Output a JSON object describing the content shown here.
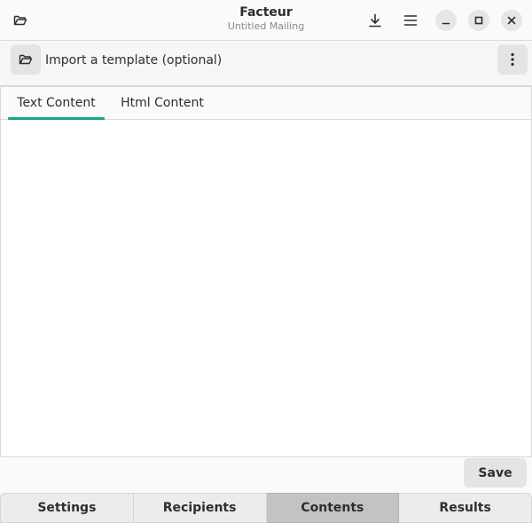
{
  "header": {
    "title": "Facteur",
    "subtitle": "Untitled Mailing",
    "icons": {
      "open": "folder-open-icon",
      "download": "download-icon",
      "menu": "hamburger-menu-icon",
      "minimize": "minimize-icon",
      "maximize": "maximize-icon",
      "close": "close-icon"
    }
  },
  "toolbar": {
    "import_label": "Import a template (optional)",
    "icons": {
      "import": "folder-open-icon",
      "more": "kebab-menu-icon"
    }
  },
  "editor_tabs": [
    {
      "label": "Text Content",
      "active": true
    },
    {
      "label": "Html Content",
      "active": false
    }
  ],
  "editor": {
    "text": ""
  },
  "actions": {
    "save_label": "Save"
  },
  "bottom_nav": [
    {
      "label": "Settings",
      "selected": false
    },
    {
      "label": "Recipients",
      "selected": false
    },
    {
      "label": "Contents",
      "selected": true
    },
    {
      "label": "Results",
      "selected": false
    }
  ],
  "colors": {
    "accent": "#1ba186",
    "selected_tab": "#c3c3c3",
    "button_bg": "#e4e4e4"
  }
}
